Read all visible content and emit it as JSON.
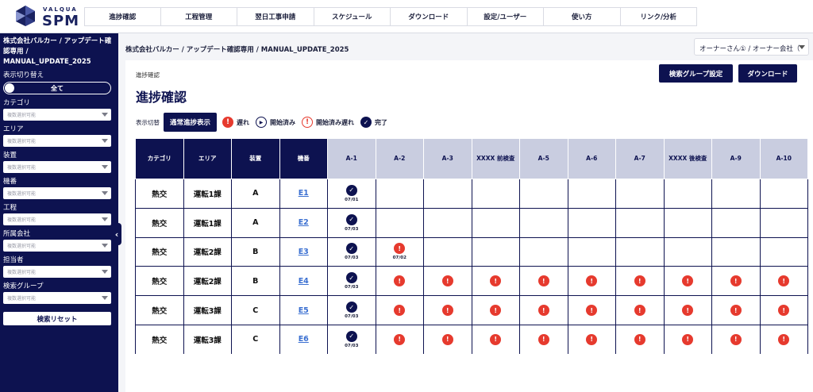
{
  "logo": {
    "small": "VALQUA",
    "big": "SPM"
  },
  "nav": [
    "進捗確認",
    "工程管理",
    "翌日工事申請",
    "スケジュール",
    "ダウンロード",
    "設定/ユーザー",
    "使い方",
    "リンク/分析"
  ],
  "sidebar": {
    "title": "株式会社バルカー / アップデート確認専用 / MANUAL_UPDATE_2025",
    "view_toggle_label": "表示切り替え",
    "toggle_value": "全て",
    "filters": [
      {
        "label": "カテゴリ",
        "placeholder": "複数選択可能"
      },
      {
        "label": "エリア",
        "placeholder": "複数選択可能"
      },
      {
        "label": "装置",
        "placeholder": "複数選択可能"
      },
      {
        "label": "機番",
        "placeholder": "複数選択可能"
      },
      {
        "label": "工程",
        "placeholder": "複数選択可能"
      },
      {
        "label": "所属会社",
        "placeholder": "複数選択可能"
      },
      {
        "label": "担当者",
        "placeholder": "複数選択可能"
      },
      {
        "label": "検索グループ",
        "placeholder": "複数選択可能"
      }
    ],
    "reset_label": "検索リセット",
    "collapse_glyph": "‹"
  },
  "breadcrumb": "株式会社バルカー / アップデート確認専用 / MANUAL_UPDATE_2025",
  "user_select": "オーナーさん① / オーナー会社（",
  "card": {
    "breadcrumb": "進捗確認",
    "title": "進捗確認",
    "search_group_btn": "検索グループ設定",
    "download_btn": "ダウンロード",
    "mode_label": "表示切替",
    "mode_btn": "通常進捗表示",
    "legend": {
      "late": "遅れ",
      "started": "開始済み",
      "started_late": "開始済み遅れ",
      "done": "完了"
    },
    "icons": {
      "late": "!",
      "started": "▶",
      "started_late": "!",
      "done": "✓"
    }
  },
  "table": {
    "fixed_headers": [
      "カテゴリ",
      "エリア",
      "装置",
      "機番"
    ],
    "step_headers": [
      "A-1",
      "A-2",
      "A-3",
      "XXXX 前検査",
      "A-5",
      "A-6",
      "A-7",
      "XXXX 後検査",
      "A-9",
      "A-10"
    ],
    "rows": [
      {
        "category": "熱交",
        "area": "運転1課",
        "device": "A",
        "machine": "E1",
        "cells": [
          {
            "s": "done",
            "d": "07/01"
          },
          {},
          {},
          {},
          {},
          {},
          {},
          {},
          {},
          {}
        ]
      },
      {
        "category": "熱交",
        "area": "運転1課",
        "device": "A",
        "machine": "E2",
        "cells": [
          {
            "s": "done",
            "d": "07/03"
          },
          {},
          {},
          {},
          {},
          {},
          {},
          {},
          {},
          {}
        ]
      },
      {
        "category": "熱交",
        "area": "運転2課",
        "device": "B",
        "machine": "E3",
        "cells": [
          {
            "s": "done",
            "d": "07/03"
          },
          {
            "s": "late",
            "d": "07/02"
          },
          {},
          {},
          {},
          {},
          {},
          {},
          {},
          {}
        ]
      },
      {
        "category": "熱交",
        "area": "運転2課",
        "device": "B",
        "machine": "E4",
        "cells": [
          {
            "s": "done",
            "d": "07/03"
          },
          {
            "s": "late"
          },
          {
            "s": "late"
          },
          {
            "s": "late"
          },
          {
            "s": "late"
          },
          {
            "s": "late"
          },
          {
            "s": "late"
          },
          {
            "s": "late"
          },
          {
            "s": "late"
          },
          {
            "s": "late"
          }
        ]
      },
      {
        "category": "熱交",
        "area": "運転3課",
        "device": "C",
        "machine": "E5",
        "cells": [
          {
            "s": "done",
            "d": "07/03"
          },
          {
            "s": "late"
          },
          {
            "s": "late"
          },
          {
            "s": "late"
          },
          {
            "s": "late"
          },
          {
            "s": "late"
          },
          {
            "s": "late"
          },
          {
            "s": "late"
          },
          {
            "s": "late"
          },
          {
            "s": "late"
          }
        ]
      },
      {
        "category": "熱交",
        "area": "運転3課",
        "device": "C",
        "machine": "E6",
        "cells": [
          {
            "s": "done",
            "d": "07/03"
          },
          {
            "s": "late"
          },
          {
            "s": "late"
          },
          {
            "s": "late"
          },
          {
            "s": "late"
          },
          {
            "s": "late"
          },
          {
            "s": "late"
          },
          {
            "s": "late"
          },
          {
            "s": "late"
          },
          {
            "s": "late"
          }
        ]
      }
    ]
  },
  "colors": {
    "navy": "#0d1250",
    "red": "#e63a2e",
    "header_light": "#c9cde0",
    "link": "#3a6fd1"
  }
}
